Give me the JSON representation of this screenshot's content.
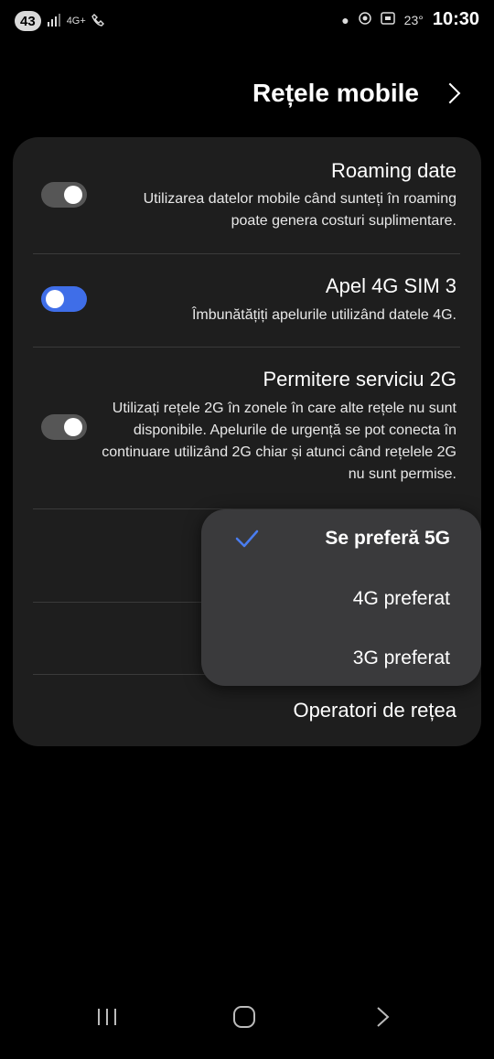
{
  "status_bar": {
    "badge": "43",
    "network": "4G+",
    "temperature": "23°",
    "time": "10:30"
  },
  "header": {
    "title": "Rețele mobile"
  },
  "settings": [
    {
      "title": "Roaming date",
      "description": "Utilizarea datelor mobile când sunteți în roaming poate genera costuri suplimentare.",
      "toggle": "off"
    },
    {
      "title": "Apel 4G SIM 3",
      "description": "Îmbunătățiți apelurile utilizând datele 4G.",
      "toggle": "on"
    },
    {
      "title": "Permitere serviciu 2G",
      "description": "Utilizați rețele 2G în zonele în care alte rețele nu sunt disponibile. Apelurile de urgență se pot conecta în continuare utilizând 2G chiar și atunci când rețelele 2G nu sunt permise.",
      "toggle": "off"
    }
  ],
  "network_operators_label": "Operatori de rețea",
  "network_mode_menu": {
    "options": [
      "Se preferă 5G",
      "4G preferat",
      "3G preferat"
    ],
    "selected": "Se preferă 5G"
  },
  "colors": {
    "accent": "#3f6ee8",
    "card": "#1e1e1e",
    "popup": "#3a3a3c",
    "background": "#000000"
  },
  "icons": [
    "back-icon",
    "home-icon",
    "recents-icon",
    "checkmark-icon",
    "chevron-right-icon"
  ]
}
